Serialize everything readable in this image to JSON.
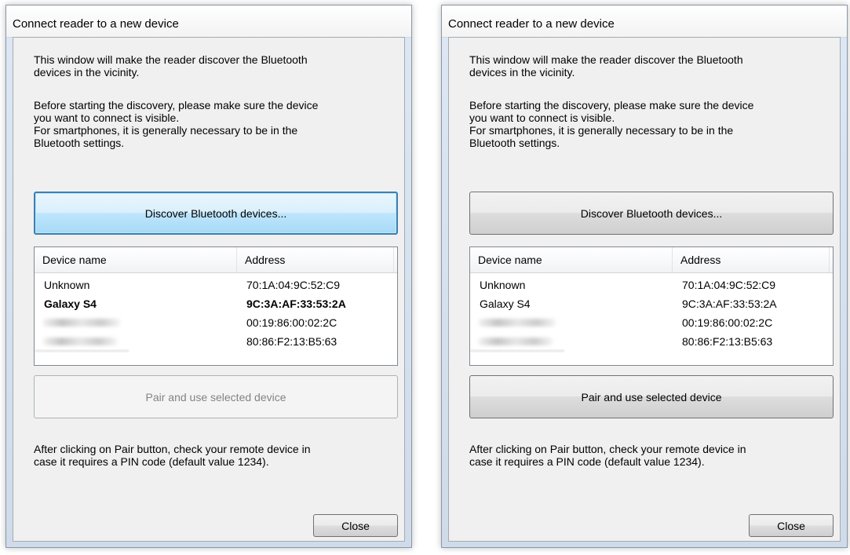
{
  "windows": [
    {
      "title": "Connect reader to a new device",
      "intro_line1": "This window will make the reader discover the Bluetooth",
      "intro_line2": "devices in the vicinity.",
      "before_line1": "Before starting the discovery, please make sure the device",
      "before_line2": "you want to connect is visible.",
      "before_line3": "For smartphones, it is generally necessary to be in the",
      "before_line4": "Bluetooth settings.",
      "discover_button": "Discover Bluetooth devices...",
      "discover_state": "focused",
      "columns": {
        "name": "Device name",
        "address": "Address"
      },
      "devices": [
        {
          "name": "Unknown",
          "address": "70:1A:04:9C:52:C9",
          "selected": false
        },
        {
          "name": "Galaxy S4",
          "address": "9C:3A:AF:33:53:2A",
          "selected": true
        },
        {
          "name": "",
          "address": "00:19:86:00:02:2C",
          "selected": false,
          "obscured": true
        },
        {
          "name": "",
          "address": "80:86:F2:13:B5:63",
          "selected": false,
          "obscured": true
        }
      ],
      "pair_button": "Pair and use selected device",
      "pair_state": "disabled",
      "after_line1": "After clicking on Pair button, check your remote device in",
      "after_line2": "case it requires a PIN code (default value 1234).",
      "close_button": "Close"
    },
    {
      "title": "Connect reader to a new device",
      "intro_line1": "This window will make the reader discover the Bluetooth",
      "intro_line2": "devices in the vicinity.",
      "before_line1": "Before starting the discovery, please make sure the device",
      "before_line2": "you want to connect is visible.",
      "before_line3": "For smartphones, it is generally necessary to be in the",
      "before_line4": "Bluetooth settings.",
      "discover_button": "Discover Bluetooth devices...",
      "discover_state": "normal",
      "columns": {
        "name": "Device name",
        "address": "Address"
      },
      "devices": [
        {
          "name": "Unknown",
          "address": "70:1A:04:9C:52:C9",
          "selected": false
        },
        {
          "name": "Galaxy S4",
          "address": "9C:3A:AF:33:53:2A",
          "selected": false
        },
        {
          "name": "",
          "address": "00:19:86:00:02:2C",
          "selected": false,
          "obscured": true
        },
        {
          "name": "",
          "address": "80:86:F2:13:B5:63",
          "selected": false,
          "obscured": true
        }
      ],
      "pair_button": "Pair and use selected device",
      "pair_state": "enabled",
      "after_line1": "After clicking on Pair button, check your remote device in",
      "after_line2": "case it requires a PIN code (default value 1234).",
      "close_button": "Close"
    }
  ]
}
